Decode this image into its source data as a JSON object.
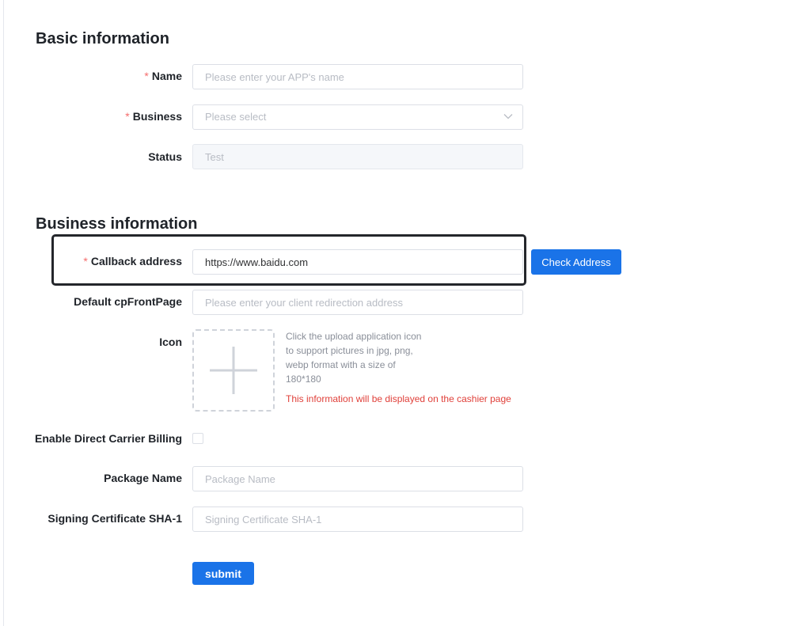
{
  "basic": {
    "title": "Basic information",
    "name": {
      "label": "Name",
      "required": "*",
      "placeholder": "Please enter your APP's name",
      "value": ""
    },
    "business": {
      "label": "Business",
      "required": "*",
      "placeholder": "Please select",
      "icon": "chevron-down-icon"
    },
    "status": {
      "label": "Status",
      "value": "Test"
    }
  },
  "business_info": {
    "title": "Business information",
    "callback": {
      "label": "Callback address",
      "required": "*",
      "value": "https://www.baidu.com",
      "button": "Check Address"
    },
    "front_page": {
      "label": "Default cpFrontPage",
      "placeholder": "Please enter your client redirection address",
      "value": ""
    },
    "icon": {
      "label": "Icon",
      "upload_icon": "plus-icon",
      "hint": "Click the upload application icon to support pictures in jpg, png, webp format with a size of 180*180",
      "hint_lines": [
        "Click the upload application icon",
        "to support pictures in jpg, png,",
        "webp format with a size of",
        "180*180"
      ],
      "warning": "This information will be displayed on the cashier page"
    },
    "carrier_billing": {
      "label": "Enable Direct Carrier Billing",
      "checked": false
    },
    "package_name": {
      "label": "Package Name",
      "placeholder": "Package Name",
      "value": ""
    },
    "sha1": {
      "label": "Signing Certificate SHA-1",
      "placeholder": "Signing Certificate SHA-1",
      "value": ""
    }
  },
  "actions": {
    "submit": "submit"
  },
  "colors": {
    "primary": "#1a73e8",
    "required": "#f56c6c",
    "warning": "#e0403a",
    "highlight_border": "#24262b"
  }
}
